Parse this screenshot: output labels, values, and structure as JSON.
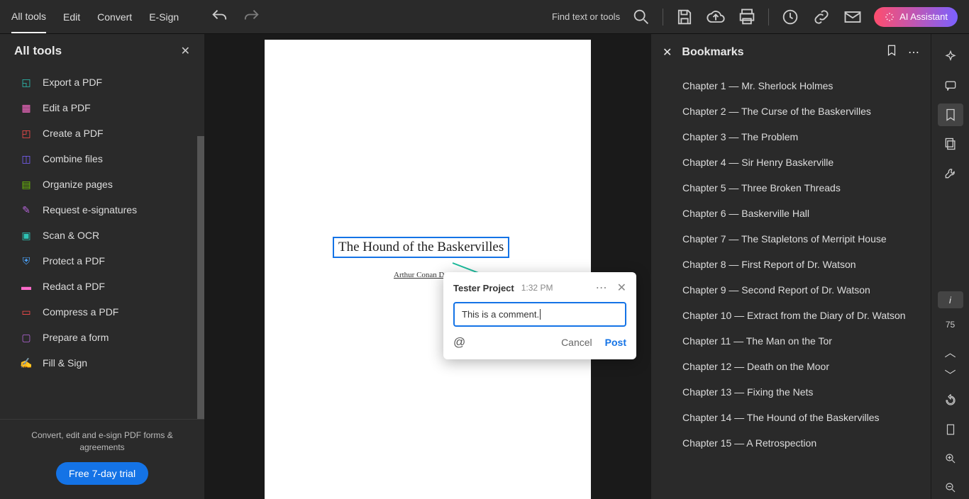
{
  "topbar": {
    "items": [
      "All tools",
      "Edit",
      "Convert",
      "E-Sign"
    ],
    "search_label": "Find text or tools",
    "ai_label": "AI Assistant"
  },
  "left": {
    "title": "All tools",
    "tools": [
      "Export a PDF",
      "Edit a PDF",
      "Create a PDF",
      "Combine files",
      "Organize pages",
      "Request e-signatures",
      "Scan & OCR",
      "Protect a PDF",
      "Redact a PDF",
      "Compress a PDF",
      "Prepare a form",
      "Fill & Sign"
    ],
    "footer_text": "Convert, edit and e-sign PDF forms & agreements",
    "trial_label": "Free 7-day trial"
  },
  "doc": {
    "title": "The Hound of the Baskervilles",
    "author": "Arthur Conan Doyle"
  },
  "comment": {
    "author": "Tester Project",
    "time": "1:32 PM",
    "text": "This is a comment.",
    "cancel": "Cancel",
    "post": "Post"
  },
  "bookmarks": {
    "title": "Bookmarks",
    "items": [
      "Chapter 1 — Mr. Sherlock Holmes",
      "Chapter 2 — The Curse of the Baskervilles",
      "Chapter 3 — The Problem",
      "Chapter 4 — Sir Henry Baskerville",
      "Chapter 5 — Three Broken Threads",
      "Chapter 6 — Baskerville Hall",
      "Chapter 7 — The Stapletons of Merripit House",
      "Chapter 8 — First Report of Dr. Watson",
      "Chapter 9 — Second Report of Dr. Watson",
      "Chapter 10 — Extract from the Diary of Dr. Watson",
      "Chapter 11 — The Man on the Tor",
      "Chapter 12 — Death on the Moor",
      "Chapter 13 — Fixing the Nets",
      "Chapter 14 — The Hound of the Baskervilles",
      "Chapter 15 — A Retrospection"
    ]
  },
  "rail": {
    "page_indicator": "i",
    "page_number": "75"
  }
}
